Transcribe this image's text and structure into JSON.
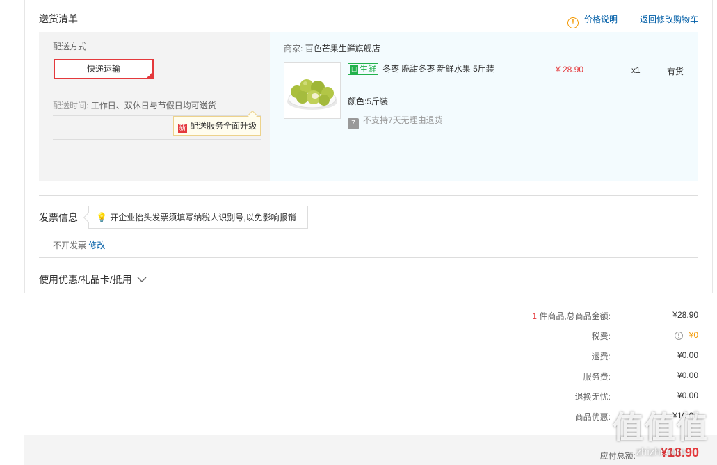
{
  "shipping": {
    "title": "送货清单",
    "price_note": "价格说明",
    "back_to_cart": "返回修改购物车",
    "method_label": "配送方式",
    "method_value": "快递运输",
    "time_label": "配送时间:",
    "time_value": "工作日、双休日与节假日均可送货",
    "upgrade_badge": "新",
    "upgrade_text": "配送服务全面升级"
  },
  "item": {
    "merchant_label": "商家:",
    "merchant_name": "百色芒果生鲜旗舰店",
    "tag": "生鲜",
    "name": "冬枣 脆甜冬枣 新鲜水果 5斤装",
    "price": "¥ 28.90",
    "qty": "x1",
    "stock": "有货",
    "color_label": "颜色:",
    "color_value": "5斤装",
    "no_return": "不支持7天无理由退货"
  },
  "invoice": {
    "title": "发票信息",
    "tip": "开企业抬头发票须填写纳税人识别号,以免影响报销",
    "status": "不开发票",
    "edit": "修改"
  },
  "coupon": {
    "label": "使用优惠/礼品卡/抵用"
  },
  "summary": {
    "count": "1",
    "count_suffix": "件商品,总商品金额:",
    "goods_total": "¥28.90",
    "tax_label": "税费:",
    "tax_value": "¥0",
    "shipping_label": "运费:",
    "shipping_value": "¥0.00",
    "service_label": "服务费:",
    "service_value": "¥0.00",
    "return_label": "退换无忧:",
    "return_value": "¥0.00",
    "discount_label": "商品优惠:",
    "discount_value": "-¥10.00",
    "payable_label": "应付总额:",
    "payable_value": "¥18.90"
  },
  "watermark": {
    "glyphs": "值值值",
    "site": "zhizhi.com"
  },
  "colors": {
    "accent_red": "#e4393c",
    "link_blue": "#005ea7",
    "fresh_green": "#22b14c",
    "warn_orange": "#f39800"
  }
}
